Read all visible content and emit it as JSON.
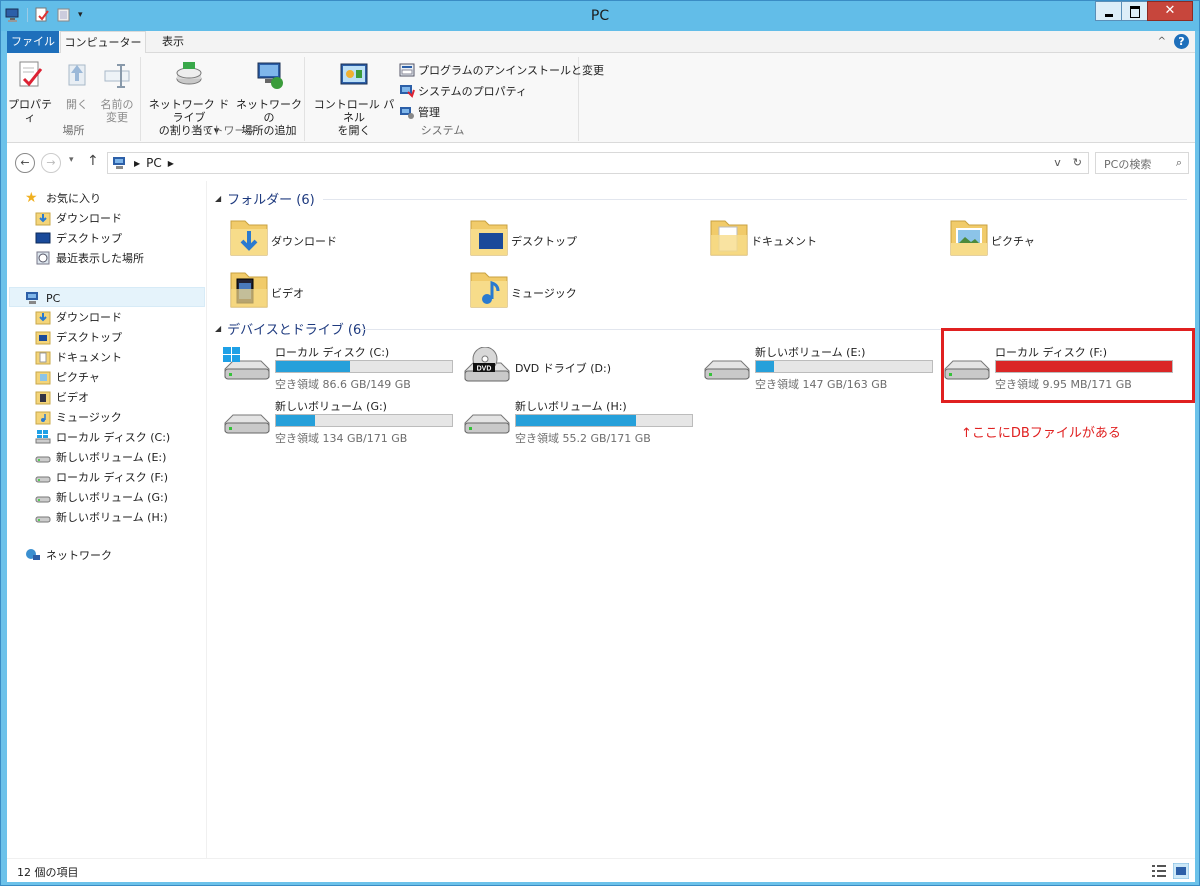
{
  "window": {
    "title": "PC"
  },
  "ribbon": {
    "tabs": [
      "ファイル",
      "コンピューター",
      "表示"
    ],
    "groups": {
      "location": {
        "label": "場所",
        "properties": "プロパティ",
        "open": "開く",
        "rename_line1": "名前の",
        "rename_line2": "変更"
      },
      "network": {
        "label": "ネットワーク",
        "map_line1": "ネットワーク ドライブ",
        "map_line2": "の割り当て",
        "add_line1": "ネットワークの",
        "add_line2": "場所の追加"
      },
      "system": {
        "label": "システム",
        "control_line1": "コントロール パネル",
        "control_line2": "を開く",
        "uninstall": "プログラムのアンインストールと変更",
        "sysprops": "システムのプロパティ",
        "manage": "管理"
      }
    }
  },
  "address": {
    "path": "PC",
    "search_placeholder": "PCの検索"
  },
  "nav": {
    "favorites": "お気に入り",
    "fav_items": [
      "ダウンロード",
      "デスクトップ",
      "最近表示した場所"
    ],
    "pc": "PC",
    "pc_items": [
      "ダウンロード",
      "デスクトップ",
      "ドキュメント",
      "ピクチャ",
      "ビデオ",
      "ミュージック",
      "ローカル ディスク (C:)",
      "新しいボリューム (E:)",
      "ローカル ディスク (F:)",
      "新しいボリューム (G:)",
      "新しいボリューム (H:)"
    ],
    "network": "ネットワーク"
  },
  "folders_section": {
    "title": "フォルダー (6)"
  },
  "folders": [
    "ダウンロード",
    "デスクトップ",
    "ドキュメント",
    "ピクチャ",
    "ビデオ",
    "ミュージック"
  ],
  "drives_section": {
    "title": "デバイスとドライブ (6)"
  },
  "drives": [
    {
      "name": "ローカル ディスク (C:)",
      "free": "空き領域 86.6 GB/149 GB",
      "used_fraction": 0.42
    },
    {
      "name": "DVD ドライブ (D:)"
    },
    {
      "name": "新しいボリューム (E:)",
      "free": "空き領域 147 GB/163 GB",
      "used_fraction": 0.1
    },
    {
      "name": "ローカル ディスク (F:)",
      "free": "空き領域 9.95 MB/171 GB",
      "used_fraction": 1.0
    },
    {
      "name": "新しいボリューム (G:)",
      "free": "空き領域 134 GB/171 GB",
      "used_fraction": 0.22
    },
    {
      "name": "新しいボリューム (H:)",
      "free": "空き領域 55.2 GB/171 GB",
      "used_fraction": 0.68
    }
  ],
  "annotation": {
    "text": "↑ここにDBファイルがある",
    "color": "#e02020"
  },
  "status": {
    "count": "12 個の項目"
  },
  "colors": {
    "bar_normal": "#26a0da",
    "bar_full": "#da2626",
    "accent": "#1e6fbb"
  }
}
